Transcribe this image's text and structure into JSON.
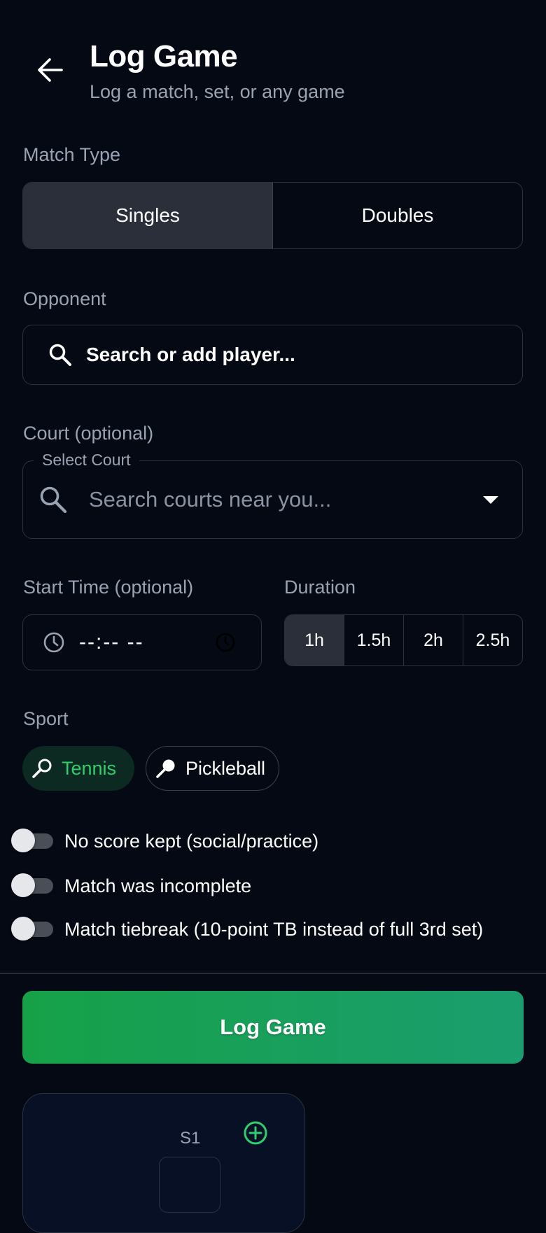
{
  "header": {
    "title": "Log Game",
    "subtitle": "Log a match, set, or any game",
    "back_icon": "arrow-left-icon"
  },
  "match_type": {
    "label": "Match Type",
    "options": [
      "Singles",
      "Doubles"
    ],
    "selected": "Singles"
  },
  "opponent": {
    "label": "Opponent",
    "button_text": "Search or add player...",
    "icon": "search-icon"
  },
  "court": {
    "label": "Court (optional)",
    "field_label": "Select Court",
    "placeholder": "Search courts near you...",
    "icon": "search-icon"
  },
  "start_time": {
    "label": "Start Time (optional)",
    "value": "--:-- --"
  },
  "duration": {
    "label": "Duration",
    "options": [
      "1h",
      "1.5h",
      "2h",
      "2.5h"
    ],
    "selected": "1h"
  },
  "sport": {
    "label": "Sport",
    "options": [
      "Tennis",
      "Pickleball"
    ],
    "selected": "Tennis"
  },
  "toggles": [
    {
      "label": "No score kept (social/practice)",
      "on": false
    },
    {
      "label": "Match was incomplete",
      "on": false
    },
    {
      "label": "Match tiebreak (10-point TB instead of full 3rd set)",
      "on": false
    }
  ],
  "submit": {
    "label": "Log Game"
  },
  "score": {
    "set_label": "S1"
  },
  "colors": {
    "background": "#050914",
    "accent_green": "#2fcf6e",
    "button_gradient_start": "#16a148",
    "button_gradient_end": "#1a9e6f",
    "border": "#2b3240",
    "muted_text": "#9aa3b2"
  }
}
